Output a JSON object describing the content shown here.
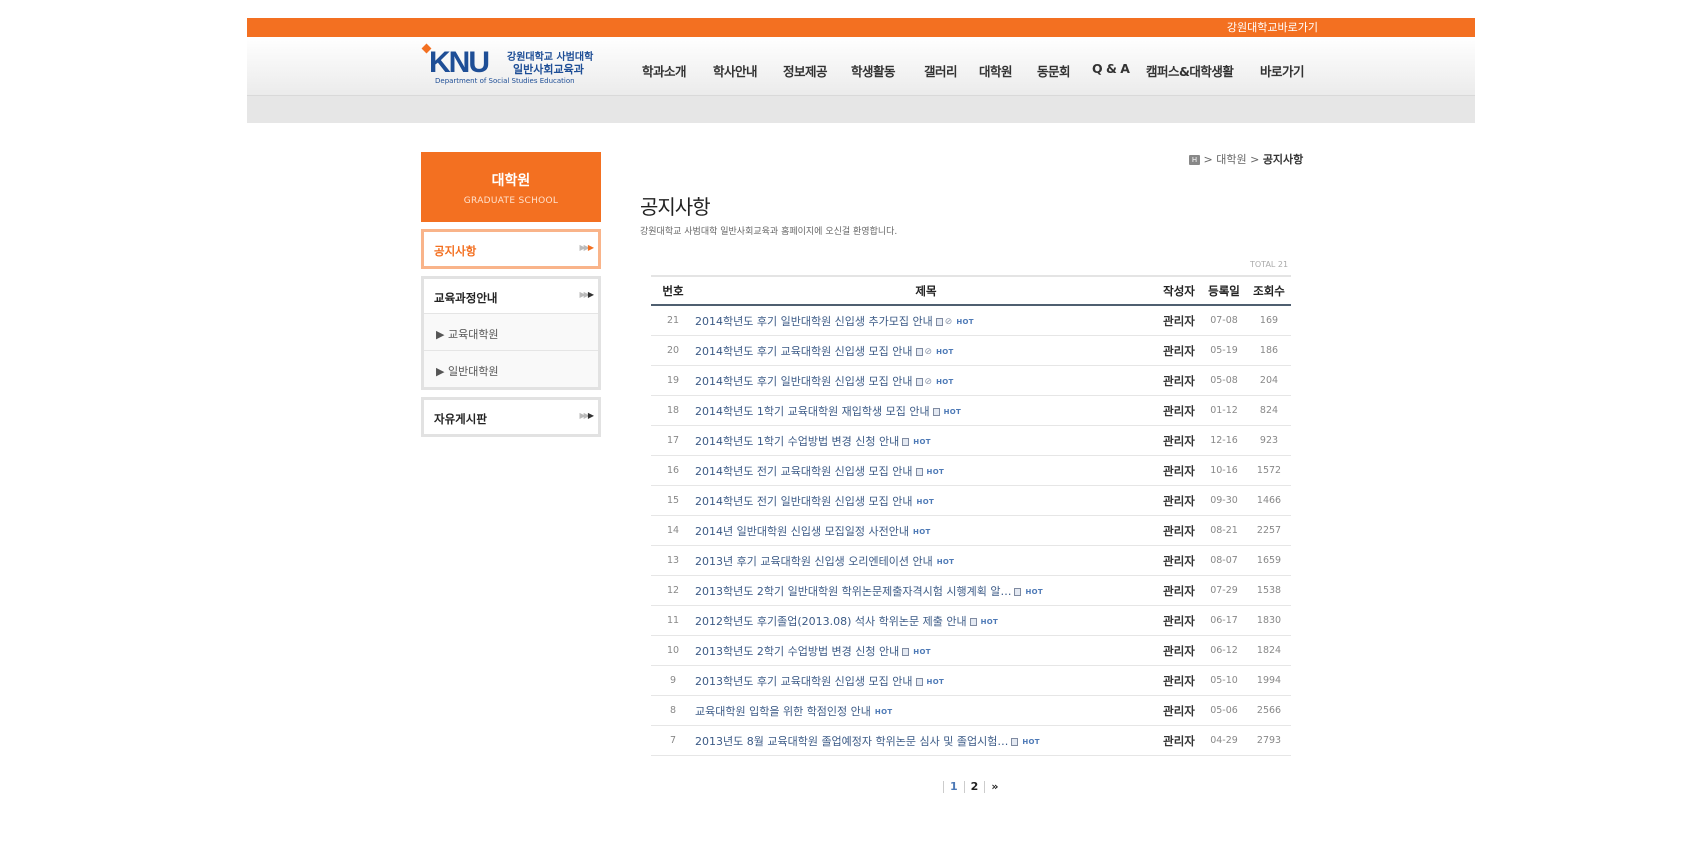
{
  "topbar": {
    "link": "강원대학교바로가기"
  },
  "logo": {
    "mark": "KNU",
    "line1": "강원대학교 사범대학",
    "line2": "일반사회교육과",
    "line3": "Department of Social Studies Education"
  },
  "gnb": [
    {
      "label": "학과소개"
    },
    {
      "label": "학사안내"
    },
    {
      "label": "정보제공"
    },
    {
      "label": "학생활동"
    },
    {
      "label": "갤러리"
    },
    {
      "label": "대학원"
    },
    {
      "label": "동문회"
    },
    {
      "label": "Q & A"
    },
    {
      "label": "캠퍼스&대학생활"
    },
    {
      "label": "바로가기"
    }
  ],
  "lnb": {
    "title": "대학원",
    "subtitle": "GRADUATE SCHOOL",
    "notice": "공지사항",
    "curriculum": "교육과정안내",
    "sub1": "▶ 교육대학원",
    "sub2": "▶ 일반대학원",
    "freeboard": "자유게시판"
  },
  "breadcrumb": {
    "home": "H",
    "sep": ">",
    "level1": "대학원",
    "current": "공지사항"
  },
  "page": {
    "title": "공지사항",
    "desc": "강원대학교 사범대학 일반사회교육과 홈페이지에 오신걸 환영합니다.",
    "total": "TOTAL 21"
  },
  "board": {
    "headers": {
      "num": "번호",
      "subject": "제목",
      "author": "작성자",
      "date": "등록일",
      "views": "조회수"
    },
    "hot_label": "HOT",
    "rows": [
      {
        "num": "21",
        "subject": "2014학년도 후기 일반대학원 신입생 추가모집 안내",
        "file": true,
        "clip": true,
        "author": "관리자",
        "date": "07-08",
        "views": "169"
      },
      {
        "num": "20",
        "subject": "2014학년도 후기 교육대학원 신입생 모집 안내",
        "file": true,
        "clip": true,
        "author": "관리자",
        "date": "05-19",
        "views": "186"
      },
      {
        "num": "19",
        "subject": "2014학년도 후기 일반대학원 신입생 모집 안내",
        "file": true,
        "clip": true,
        "author": "관리자",
        "date": "05-08",
        "views": "204"
      },
      {
        "num": "18",
        "subject": "2014학년도 1학기 교육대학원 재입학생 모집 안내",
        "file": true,
        "clip": false,
        "author": "관리자",
        "date": "01-12",
        "views": "824"
      },
      {
        "num": "17",
        "subject": "2014학년도 1학기 수업방법 변경 신청 안내",
        "file": true,
        "clip": false,
        "author": "관리자",
        "date": "12-16",
        "views": "923"
      },
      {
        "num": "16",
        "subject": "2014학년도 전기 교육대학원 신입생 모집 안내",
        "file": true,
        "clip": false,
        "author": "관리자",
        "date": "10-16",
        "views": "1572"
      },
      {
        "num": "15",
        "subject": "2014학년도 전기 일반대학원 신입생 모집 안내",
        "file": false,
        "clip": false,
        "author": "관리자",
        "date": "09-30",
        "views": "1466"
      },
      {
        "num": "14",
        "subject": "2014년 일반대학원 신입생 모집일정 사전안내",
        "file": false,
        "clip": false,
        "author": "관리자",
        "date": "08-21",
        "views": "2257"
      },
      {
        "num": "13",
        "subject": "2013년 후기 교육대학원 신입생 오리엔테이션 안내",
        "file": false,
        "clip": false,
        "author": "관리자",
        "date": "08-07",
        "views": "1659"
      },
      {
        "num": "12",
        "subject": "2013학년도 2학기 일반대학원 학위논문제출자격시험 시행계획 알…",
        "file": true,
        "clip": false,
        "author": "관리자",
        "date": "07-29",
        "views": "1538"
      },
      {
        "num": "11",
        "subject": "2012학년도 후기졸업(2013.08) 석사 학위논문 제출 안내",
        "file": true,
        "clip": false,
        "author": "관리자",
        "date": "06-17",
        "views": "1830"
      },
      {
        "num": "10",
        "subject": "2013학년도 2학기 수업방법 변경 신청 안내",
        "file": true,
        "clip": false,
        "author": "관리자",
        "date": "06-12",
        "views": "1824"
      },
      {
        "num": "9",
        "subject": "2013학년도 후기 교육대학원 신입생 모집 안내",
        "file": true,
        "clip": false,
        "author": "관리자",
        "date": "05-10",
        "views": "1994"
      },
      {
        "num": "8",
        "subject": "교육대학원 입학을 위한 학점인정 안내",
        "file": false,
        "clip": false,
        "author": "관리자",
        "date": "05-06",
        "views": "2566"
      },
      {
        "num": "7",
        "subject": "2013년도 8월 교육대학원 졸업예정자 학위논문 심사 및 졸업시험…",
        "file": true,
        "clip": false,
        "author": "관리자",
        "date": "04-29",
        "views": "2793"
      }
    ]
  },
  "pager": {
    "page1": "1",
    "page2": "2",
    "next": "»"
  }
}
